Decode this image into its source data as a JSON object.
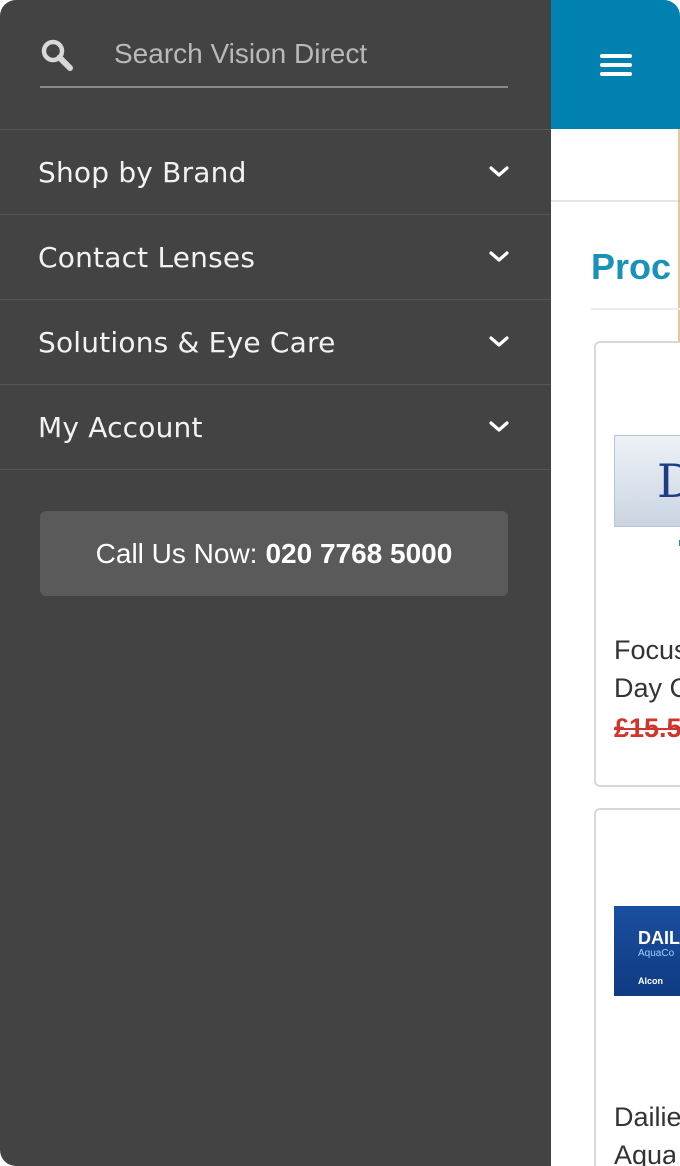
{
  "search": {
    "placeholder": "Search Vision Direct",
    "icon": "search-icon"
  },
  "menu": {
    "items": [
      {
        "label": "Shop by Brand",
        "icon": "chevron-down-icon"
      },
      {
        "label": "Contact Lenses",
        "icon": "chevron-down-icon"
      },
      {
        "label": "Solutions & Eye Care",
        "icon": "chevron-down-icon"
      },
      {
        "label": "My Account",
        "icon": "chevron-down-icon"
      }
    ]
  },
  "call": {
    "prefix": "Call Us Now:",
    "number": "020 7768 5000"
  },
  "page": {
    "heading": "Proc",
    "products": [
      {
        "title_line1": "Focus",
        "title_line2": "Day C",
        "price": "£15.5",
        "image_text": "D"
      },
      {
        "title_line1": "Dailie",
        "title_line2": "Aqua",
        "image_text_line1": "DAIL",
        "image_text_line2": "AquaCo",
        "image_text_line3": "Alcon"
      }
    ]
  },
  "colors": {
    "drawer": "#434343",
    "header": "#0181b0",
    "accent": "#1a91b8",
    "price": "#d0342c"
  }
}
